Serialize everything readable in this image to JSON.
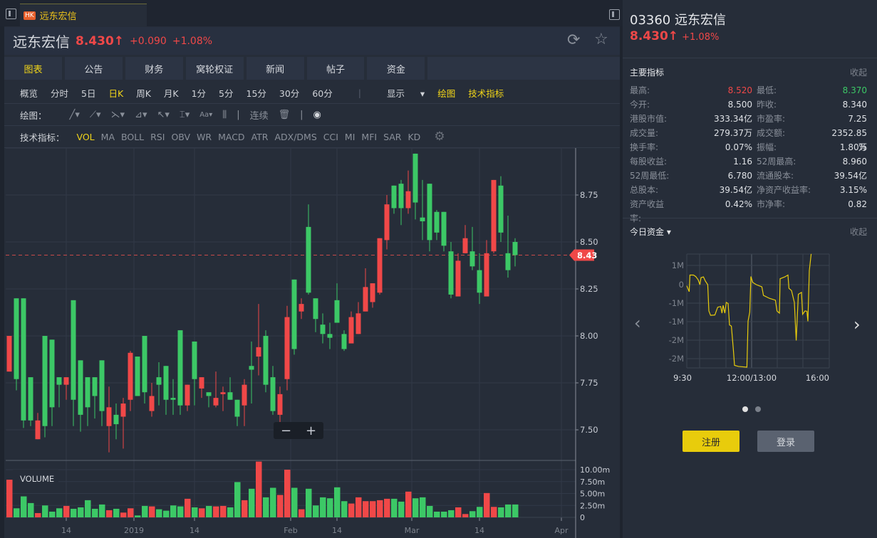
{
  "tab": {
    "badge": "HK",
    "title": "远东宏信"
  },
  "header": {
    "name": "远东宏信",
    "price": "8.430",
    "arrow": "↑",
    "change": "+0.090",
    "change_pct": "+1.08%"
  },
  "nav_tabs": [
    "图表",
    "公告",
    "财务",
    "窝轮权证",
    "新闻",
    "帖子",
    "资金"
  ],
  "periods": [
    "概览",
    "分时",
    "5日",
    "日K",
    "周K",
    "月K",
    "1分",
    "5分",
    "15分",
    "30分",
    "60分"
  ],
  "period_active": "日K",
  "display_label": "显示",
  "draw_label": "绘图",
  "tech_label": "技术指标",
  "draw_row": {
    "label": "绘图：",
    "continuous": "连续"
  },
  "indicator_row": {
    "label": "技术指标：",
    "items": [
      "VOL",
      "MA",
      "BOLL",
      "RSI",
      "OBV",
      "WR",
      "MACD",
      "ATR",
      "ADX/DMS",
      "CCI",
      "MI",
      "MFI",
      "SAR",
      "KD"
    ]
  },
  "colors": {
    "up": "#f04848",
    "down": "#3cc866",
    "accent": "#f0d419"
  },
  "chart_data": {
    "type": "candlestick",
    "price_axis": {
      "ticks": [
        "8.75",
        "8.50",
        "8.25",
        "8.00",
        "7.75",
        "7.50"
      ],
      "range": [
        7.34,
        9.0
      ]
    },
    "last_price_label": "8.43",
    "last_price": 8.43,
    "volume_label": "VOLUME",
    "volume_axis": {
      "ticks": [
        "10.00m",
        "7.50m",
        "5.00m",
        "2.50m",
        "0"
      ]
    },
    "x_ticks": [
      {
        "label": "14",
        "index": 8
      },
      {
        "label": "2019",
        "index": 17.5
      },
      {
        "label": "14",
        "index": 26
      },
      {
        "label": "Feb",
        "index": 39.5
      },
      {
        "label": "14",
        "index": 46
      },
      {
        "label": "Mar",
        "index": 56.5
      },
      {
        "label": "14",
        "index": 66
      },
      {
        "label": "Apr",
        "index": 77.5
      }
    ],
    "ohlc": [
      [
        7.81,
        8.0,
        7.81,
        8.0
      ],
      [
        8.2,
        8.2,
        7.71,
        7.77
      ],
      [
        8.2,
        8.2,
        7.51,
        7.55
      ],
      [
        7.78,
        7.78,
        7.52,
        7.55
      ],
      [
        7.45,
        7.59,
        7.45,
        7.55
      ],
      [
        8.0,
        8.0,
        7.46,
        7.52
      ],
      [
        7.98,
        7.98,
        7.52,
        7.62
      ],
      [
        7.78,
        7.78,
        7.62,
        7.74
      ],
      [
        7.74,
        7.78,
        7.66,
        7.78
      ],
      [
        8.19,
        8.19,
        7.52,
        7.66
      ],
      [
        7.87,
        7.87,
        7.49,
        7.58
      ],
      [
        7.78,
        7.78,
        7.52,
        7.62
      ],
      [
        7.78,
        7.78,
        7.56,
        7.68
      ],
      [
        7.87,
        7.87,
        7.52,
        7.6
      ],
      [
        7.52,
        7.73,
        7.38,
        7.62
      ],
      [
        7.58,
        7.64,
        7.45,
        7.53
      ],
      [
        7.57,
        7.67,
        7.4,
        7.64
      ],
      [
        7.66,
        7.92,
        7.6,
        7.91
      ],
      [
        7.89,
        7.89,
        7.68,
        7.68
      ],
      [
        8.0,
        8.0,
        7.64,
        7.7
      ],
      [
        7.6,
        7.75,
        7.57,
        7.68
      ],
      [
        7.78,
        7.86,
        7.63,
        7.74
      ],
      [
        7.84,
        7.84,
        7.58,
        7.66
      ],
      [
        7.67,
        7.77,
        7.58,
        7.66
      ],
      [
        8.03,
        8.03,
        7.58,
        7.63
      ],
      [
        7.63,
        7.74,
        7.6,
        7.74
      ],
      [
        7.97,
        7.97,
        7.63,
        7.77
      ],
      [
        7.72,
        7.78,
        7.67,
        7.78
      ],
      [
        7.7,
        7.7,
        7.62,
        7.68
      ],
      [
        7.63,
        7.81,
        7.62,
        7.67
      ],
      [
        7.69,
        7.73,
        7.6,
        7.7
      ],
      [
        7.7,
        7.78,
        7.66,
        7.66
      ],
      [
        7.66,
        7.66,
        7.52,
        7.57
      ],
      [
        7.63,
        7.77,
        7.52,
        7.74
      ],
      [
        7.84,
        7.97,
        7.64,
        7.82
      ],
      [
        7.89,
        8.17,
        7.79,
        7.94
      ],
      [
        8.0,
        8.03,
        7.7,
        7.74
      ],
      [
        7.78,
        7.84,
        7.58,
        7.6
      ],
      [
        7.58,
        7.73,
        7.51,
        7.69
      ],
      [
        7.77,
        8.16,
        7.71,
        8.1
      ],
      [
        8.3,
        8.3,
        7.9,
        7.93
      ],
      [
        8.13,
        8.2,
        8.09,
        8.17
      ],
      [
        8.58,
        8.7,
        8.22,
        8.23
      ],
      [
        8.2,
        8.2,
        8.02,
        8.09
      ],
      [
        8.06,
        8.12,
        7.96,
        8.01
      ],
      [
        8.01,
        8.07,
        7.93,
        7.99
      ],
      [
        8.19,
        8.28,
        8.07,
        8.07
      ],
      [
        8.01,
        8.03,
        7.92,
        7.93
      ],
      [
        7.96,
        8.13,
        7.96,
        8.1
      ],
      [
        8.01,
        8.18,
        8.01,
        8.12
      ],
      [
        8.13,
        8.36,
        8.13,
        8.26
      ],
      [
        8.18,
        8.28,
        8.15,
        8.28
      ],
      [
        8.23,
        8.52,
        8.22,
        8.52
      ],
      [
        8.51,
        8.75,
        8.46,
        8.7
      ],
      [
        8.8,
        8.8,
        8.65,
        8.68
      ],
      [
        8.81,
        8.83,
        8.59,
        8.68
      ],
      [
        8.68,
        8.88,
        8.65,
        8.77
      ],
      [
        8.97,
        8.97,
        8.62,
        8.71
      ],
      [
        8.63,
        8.83,
        8.51,
        8.61
      ],
      [
        8.81,
        8.81,
        8.45,
        8.51
      ],
      [
        8.66,
        8.67,
        8.51,
        8.55
      ],
      [
        8.66,
        8.66,
        8.45,
        8.48
      ],
      [
        8.45,
        8.5,
        8.2,
        8.22
      ],
      [
        8.21,
        8.44,
        8.21,
        8.4
      ],
      [
        8.44,
        8.59,
        8.44,
        8.52
      ],
      [
        8.45,
        8.58,
        8.35,
        8.37
      ],
      [
        8.35,
        8.44,
        8.17,
        8.23
      ],
      [
        8.21,
        8.51,
        8.21,
        8.44
      ],
      [
        8.45,
        8.83,
        8.44,
        8.83
      ],
      [
        8.8,
        8.85,
        8.5,
        8.55
      ],
      [
        8.44,
        8.64,
        8.31,
        8.35
      ],
      [
        8.5,
        8.52,
        8.37,
        8.43
      ]
    ],
    "volume_m": [
      7.9,
      1.9,
      4.4,
      3.0,
      0.9,
      2.5,
      1.2,
      1.9,
      2.4,
      1.8,
      2.1,
      3.6,
      1.8,
      2.7,
      1.5,
      1.8,
      1.0,
      1.9,
      0.4,
      2.4,
      2.3,
      1.7,
      1.4,
      2.5,
      2.3,
      3.9,
      2.1,
      1.9,
      2.4,
      2.3,
      2.4,
      2.1,
      7.4,
      3.6,
      6.0,
      11.7,
      4.2,
      6.2,
      4.7,
      10.0,
      6.2,
      1.7,
      6.0,
      2.5,
      4.2,
      4.0,
      6.3,
      3.4,
      2.9,
      4.2,
      3.4,
      3.4,
      3.6,
      3.9,
      3.9,
      3.3,
      5.4,
      4.0,
      4.2,
      2.4,
      1.2,
      1.2,
      1.5,
      2.1,
      0.7,
      1.3,
      2.2,
      5.1,
      2.2,
      2.1,
      2.7,
      2.7
    ]
  },
  "right": {
    "code": "03360",
    "name": "远东宏信",
    "price": "8.430",
    "arrow": "↑",
    "change_pct": "+1.08%",
    "indicators_title": "主要指标",
    "collapse": "收起",
    "indicators": [
      {
        "k": "最高:",
        "v": "8.520",
        "k2": "最低:",
        "v2": "8.370"
      },
      {
        "k": "今开:",
        "v": "8.500",
        "k2": "昨收:",
        "v2": "8.340"
      },
      {
        "k": "港股市值:",
        "v": "333.34亿",
        "k2": "市盈率:",
        "v2": "7.25"
      },
      {
        "k": "成交量:",
        "v": "279.37万",
        "k2": "成交额:",
        "v2": "2352.85万"
      },
      {
        "k": "换手率:",
        "v": "0.07%",
        "k2": "振幅:",
        "v2": "1.80%"
      },
      {
        "k": "每股收益:",
        "v": "1.16",
        "k2": "52周最高:",
        "v2": "8.960"
      },
      {
        "k": "52周最低:",
        "v": "6.780",
        "k2": "流通股本:",
        "v2": "39.54亿"
      },
      {
        "k": "总股本:",
        "v": "39.54亿",
        "k2": "净资产收益率:",
        "v2": "3.15%"
      },
      {
        "k": "资产收益率:",
        "v": "0.42%",
        "k2": "市净率:",
        "v2": "0.82"
      }
    ],
    "fund_title": "今日资金",
    "fund_collapse": "收起",
    "fund_chart": {
      "type": "line",
      "y_ticks": [
        "1M",
        "0",
        "-1M",
        "-1M",
        "-2M",
        "-2M"
      ],
      "x_ticks": [
        "9:30",
        "12:00/13:00",
        "16:00"
      ],
      "y_range": [
        -2.25,
        0.83
      ],
      "points": [
        [
          0,
          -0.03
        ],
        [
          0.017,
          -0.19
        ],
        [
          0.022,
          0.26
        ],
        [
          0.047,
          0.26
        ],
        [
          0.063,
          0.22
        ],
        [
          0.08,
          0.13
        ],
        [
          0.092,
          0
        ],
        [
          0.1,
          0.19
        ],
        [
          0.117,
          0.21
        ],
        [
          0.13,
          0.1
        ],
        [
          0.147,
          0
        ],
        [
          0.155,
          -0.71
        ],
        [
          0.167,
          -0.83
        ],
        [
          0.197,
          -0.82
        ],
        [
          0.217,
          -0.61
        ],
        [
          0.238,
          -0.59
        ],
        [
          0.247,
          -0.77
        ],
        [
          0.255,
          -0.56
        ],
        [
          0.267,
          -0.77
        ],
        [
          0.277,
          -0.48
        ],
        [
          0.29,
          -0.51
        ],
        [
          0.3,
          -1.09
        ],
        [
          0.313,
          -1.12
        ],
        [
          0.327,
          -1.76
        ],
        [
          0.335,
          -2.18
        ],
        [
          0.363,
          -2.21
        ],
        [
          0.422,
          -2.23
        ],
        [
          0.43,
          -0.99
        ],
        [
          0.442,
          -0.74
        ],
        [
          0.45,
          0.22
        ],
        [
          0.463,
          0.06
        ],
        [
          0.488,
          0
        ],
        [
          0.527,
          -0.06
        ],
        [
          0.538,
          -0.29
        ],
        [
          0.58,
          -0.37
        ],
        [
          0.622,
          -0.42
        ],
        [
          0.633,
          -0.71
        ],
        [
          0.65,
          -0.77
        ],
        [
          0.655,
          0.16
        ],
        [
          0.688,
          0.21
        ],
        [
          0.71,
          0.26
        ],
        [
          0.717,
          -0.1
        ],
        [
          0.735,
          -0.16
        ],
        [
          0.755,
          -0.48
        ],
        [
          0.768,
          -1.51
        ],
        [
          0.783,
          -0.26
        ],
        [
          0.805,
          -0.21
        ],
        [
          0.813,
          -0.8
        ],
        [
          0.83,
          -0.71
        ],
        [
          0.843,
          -0.72
        ],
        [
          0.85,
          -0.99
        ],
        [
          0.86,
          0.38
        ],
        [
          0.873,
          0.83
        ]
      ]
    },
    "register": "注册",
    "login": "登录"
  }
}
